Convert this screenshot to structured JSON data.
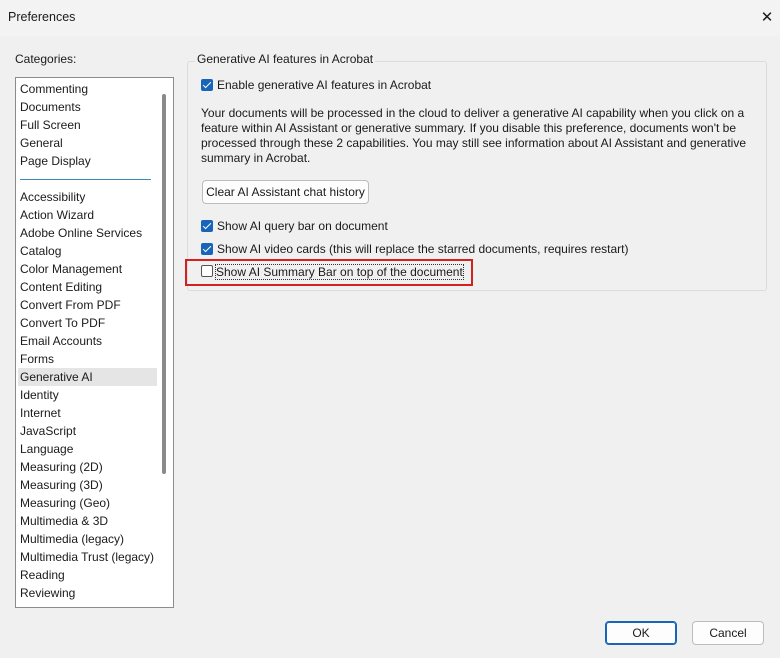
{
  "window": {
    "title": "Preferences",
    "close_glyph": "✕"
  },
  "categories": {
    "label": "Categories:",
    "top_items": [
      "Commenting",
      "Documents",
      "Full Screen",
      "General",
      "Page Display"
    ],
    "items": [
      "Accessibility",
      "Action Wizard",
      "Adobe Online Services",
      "Catalog",
      "Color Management",
      "Content Editing",
      "Convert From PDF",
      "Convert To PDF",
      "Email Accounts",
      "Forms",
      "Generative AI",
      "Identity",
      "Internet",
      "JavaScript",
      "Language",
      "Measuring (2D)",
      "Measuring (3D)",
      "Measuring (Geo)",
      "Multimedia & 3D",
      "Multimedia (legacy)",
      "Multimedia Trust (legacy)",
      "Reading",
      "Reviewing"
    ],
    "selected": "Generative AI"
  },
  "panel": {
    "group_title": "Generative AI features in Acrobat",
    "enable_label": "Enable generative AI features in Acrobat",
    "description": "Your documents will be processed in the cloud to deliver a generative AI capability when you click on a feature within AI Assistant or generative summary. If you disable this preference, documents won't be processed through these 2 capabilities. You may still see information about AI Assistant and generative summary in Acrobat.",
    "clear_history_label": "Clear AI Assistant chat history",
    "query_bar_label": "Show AI query bar on document",
    "video_cards_label": "Show AI video cards (this will replace the starred documents, requires restart)",
    "summary_bar_label": "Show AI Summary Bar on top of the document"
  },
  "checkbox_state": {
    "enable": true,
    "query_bar": true,
    "video_cards": true,
    "summary_bar": false
  },
  "buttons": {
    "ok": "OK",
    "cancel": "Cancel"
  },
  "colors": {
    "accent": "#1764b8",
    "highlight": "#d32020"
  }
}
